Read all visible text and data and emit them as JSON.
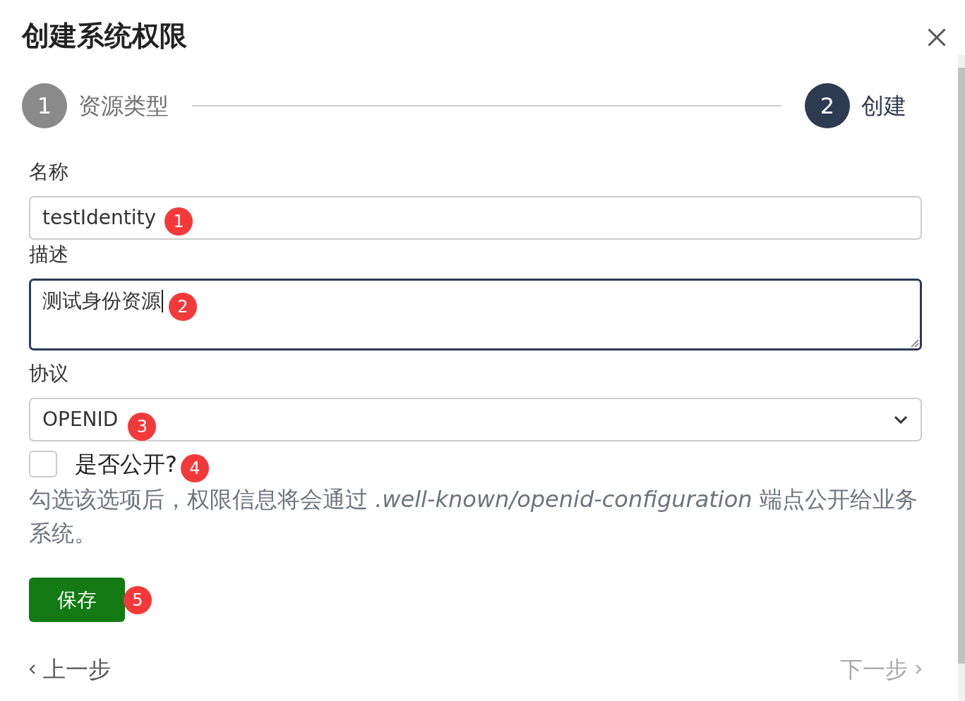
{
  "dialog": {
    "title": "创建系统权限"
  },
  "steps": [
    {
      "number": "1",
      "label": "资源类型",
      "selected": false
    },
    {
      "number": "2",
      "label": "创建",
      "selected": true
    }
  ],
  "fields": [
    {
      "kind": "input",
      "label": "名称",
      "value": "testIdentity",
      "focused": false,
      "marker": "1"
    },
    {
      "kind": "textarea",
      "label": "描述",
      "value": "测试身份资源",
      "focused": true,
      "marker": "2"
    },
    {
      "kind": "select",
      "label": "协议",
      "value": "OPENID",
      "focused": false,
      "marker": "3"
    }
  ],
  "public_checkbox": {
    "label": "是否公开?",
    "checked": false,
    "marker": "4"
  },
  "help_text": "勾选该选项后，权限信息将会通过 *.well-known/openid-configuration* 端点公开给业务系统。",
  "save_button": {
    "label": "保存",
    "marker": "5"
  },
  "nav": {
    "previous": {
      "label": "上一步",
      "disabled": false
    },
    "next": {
      "label": "下一步",
      "disabled": true
    }
  }
}
